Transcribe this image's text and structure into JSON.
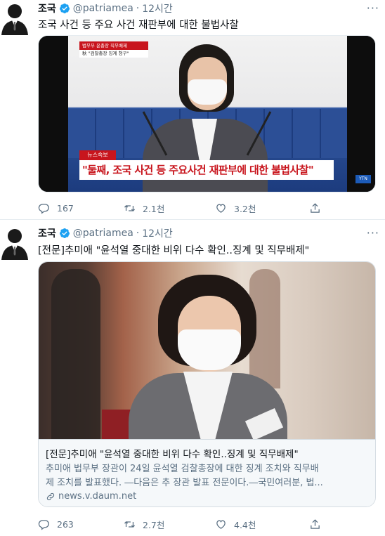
{
  "tweets": [
    {
      "author": {
        "name": "조국",
        "handle": "@patriamea",
        "time": "12시간"
      },
      "text": "조국 사건 등 주요 사건 재판부에 대한 불법사찰",
      "media": {
        "top_tag": "법무부 윤총장 직무배제",
        "top_subtag": "秋 \"검찰총장 징계 청구\"",
        "news_tag": "뉴스속보",
        "headline": "\"둘째, 조국 사건 등 주요사건 재판부에 대한 불법사찰\"",
        "channel": "YTN"
      },
      "stats": {
        "replies": "167",
        "retweets": "2.1천",
        "likes": "3.2천"
      }
    },
    {
      "author": {
        "name": "조국",
        "handle": "@patriamea",
        "time": "12시간"
      },
      "text": "[전문]추미애 \"윤석열 중대한 비위 다수 확인..징계 및 직무배제\"",
      "card": {
        "title": "[전문]추미애 \"윤석열 중대한 비위 다수 확인..징계 및 직무배제\"",
        "desc_line1": "추미애 법무부 장관이 24일 윤석열 검찰총장에 대한 징계 조치와 직무배",
        "desc_line2": "제 조치를 발표했다. ―다음은 추 장관 발표 전문이다.―국민여러분, 법...",
        "domain": "news.v.daum.net"
      },
      "stats": {
        "replies": "263",
        "retweets": "2.7천",
        "likes": "4.4천"
      }
    }
  ],
  "icons": {
    "verified": "verified-badge-icon",
    "more": "more-options-icon",
    "reply": "reply-icon",
    "retweet": "retweet-icon",
    "like": "like-icon",
    "share": "share-icon",
    "link": "link-icon"
  },
  "more_glyph": "···",
  "colors": {
    "verified": "#1da1f2",
    "muted": "#5b7083",
    "headline_red": "#c8151d",
    "studio_blue": "#1c3b7d"
  }
}
